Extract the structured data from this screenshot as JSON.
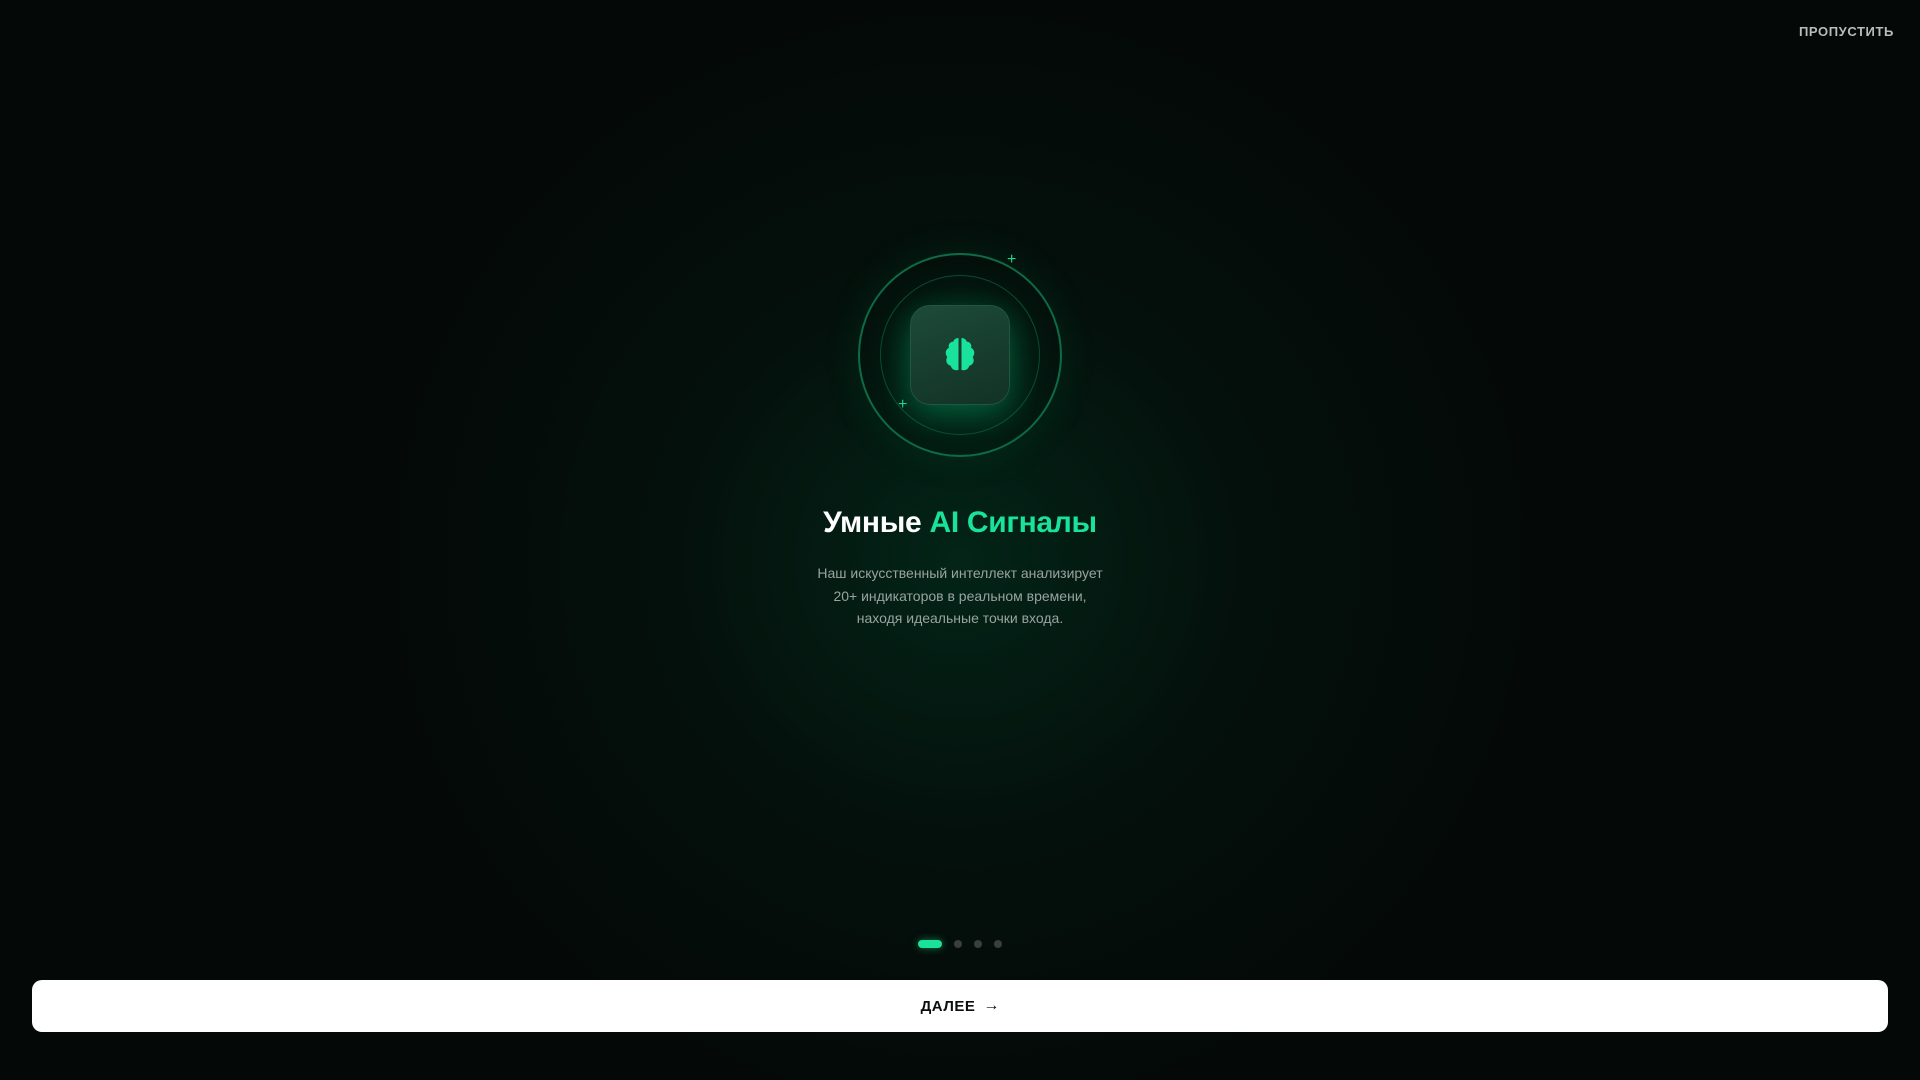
{
  "skip_label": "ПРОПУСТИТЬ",
  "title": {
    "part1": "Умные",
    "part2": "AI Сигналы"
  },
  "description": {
    "line1": "Наш искусственный интеллект анализирует",
    "line2": "20+ индикаторов в реальном времени,",
    "line3": "находя идеальные точки входа."
  },
  "pagination": {
    "total": 4,
    "current": 1
  },
  "next_button": {
    "label": "ДАЛЕЕ",
    "icon": "arrow-right-icon"
  },
  "hero_icon": "brain-icon",
  "colors": {
    "accent": "#19e39a",
    "background": "#040807",
    "button_bg": "#ffffff"
  }
}
